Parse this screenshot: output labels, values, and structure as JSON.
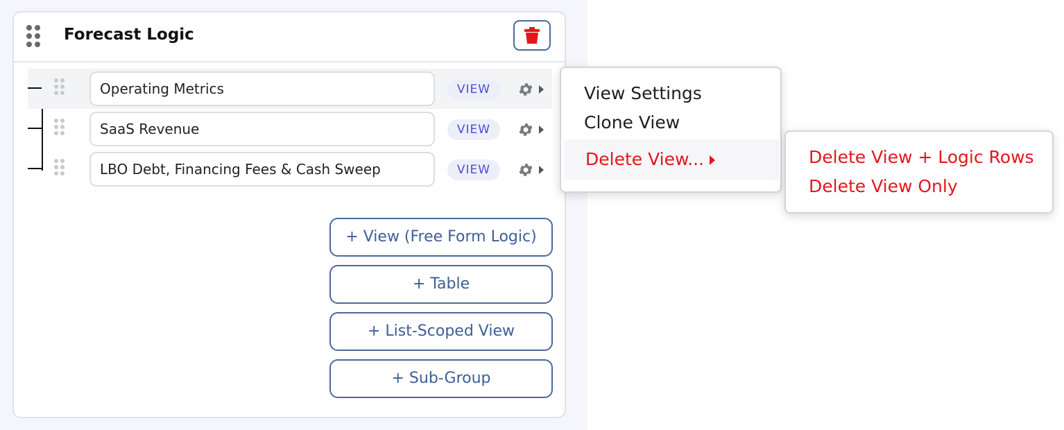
{
  "panel": {
    "title": "Forecast Logic",
    "delete_icon": "trash-icon",
    "drag_icon": "drag-handle-icon"
  },
  "views": [
    {
      "name": "Operating Metrics",
      "badge": "VIEW",
      "icon": "gear-icon"
    },
    {
      "name": "SaaS Revenue",
      "badge": "VIEW",
      "icon": "gear-icon"
    },
    {
      "name": "LBO Debt, Financing Fees & Cash Sweep",
      "badge": "VIEW",
      "icon": "gear-icon"
    }
  ],
  "add_buttons": [
    "+ View (Free Form Logic)",
    "+ Table",
    "+ List-Scoped View",
    "+ Sub-Group"
  ],
  "context_menu": {
    "items": [
      "View Settings",
      "Clone View"
    ],
    "delete_label": "Delete View...",
    "submenu": [
      "Delete View + Logic Rows",
      "Delete View Only"
    ]
  },
  "colors": {
    "accent": "#496a9a",
    "danger": "#e4161c",
    "badge_bg": "#eceefa",
    "badge_text": "#4d4fd0"
  }
}
